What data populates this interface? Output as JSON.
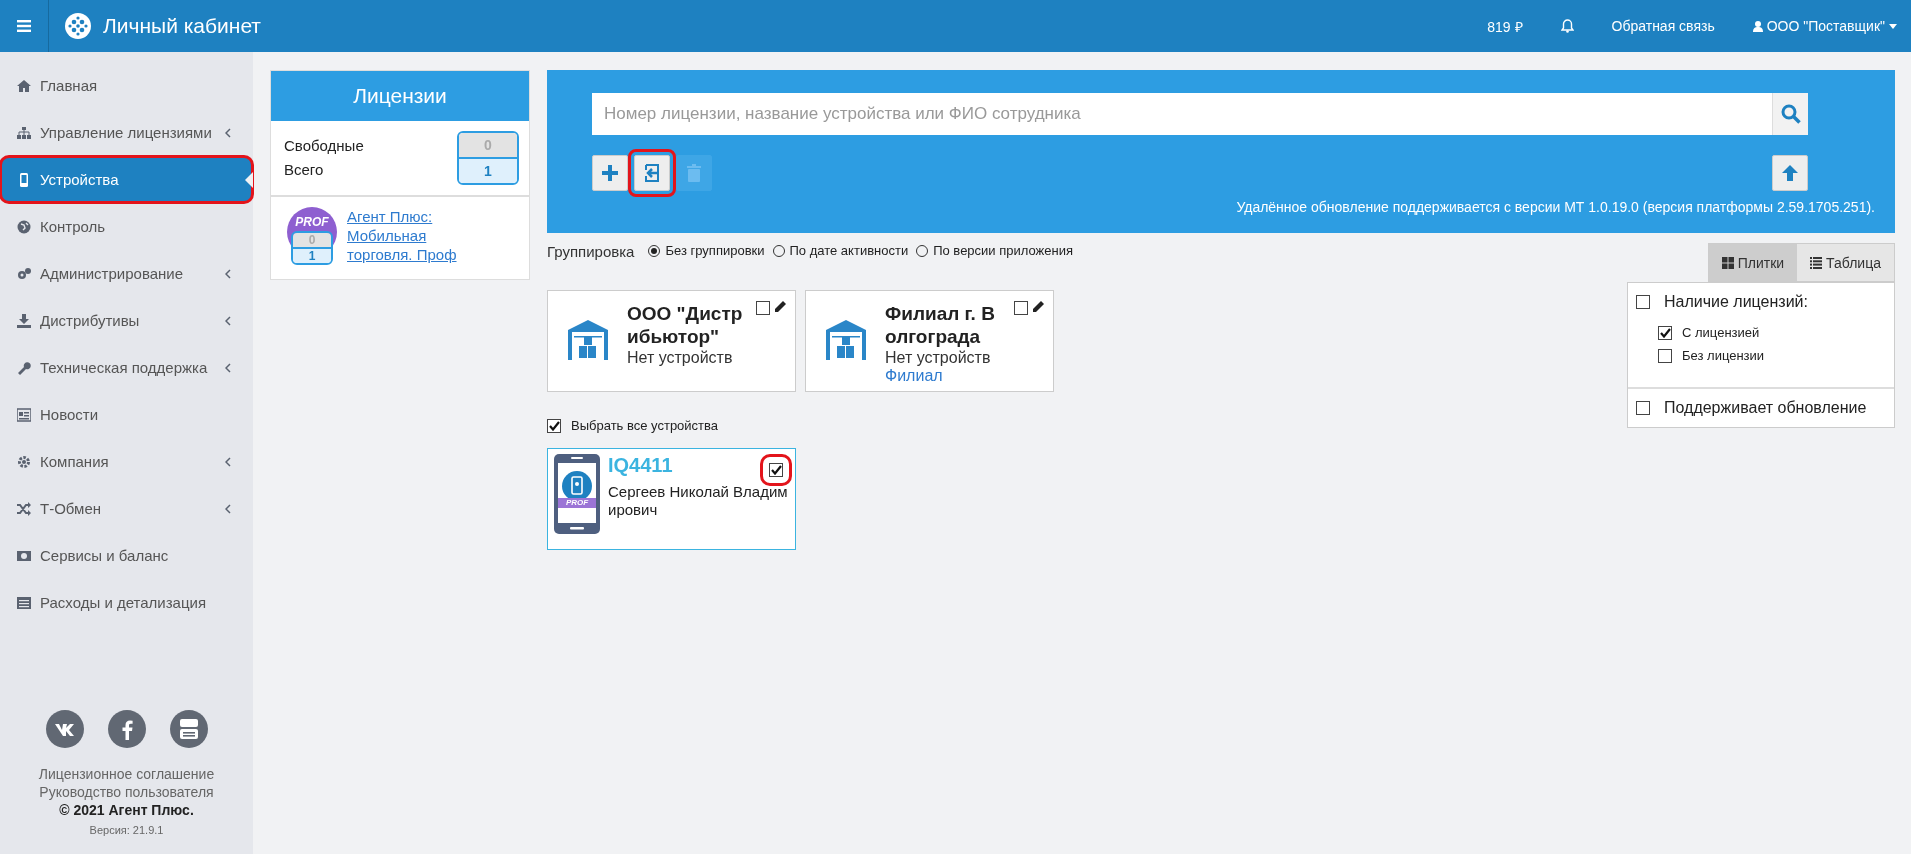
{
  "header": {
    "title": "Личный кабинет",
    "balance": "819 ₽",
    "feedback": "Обратная связь",
    "account": "ООО \"Поставщик\""
  },
  "sidebar": {
    "items": [
      {
        "label": "Главная",
        "has_submenu": false,
        "selected": false,
        "highlighted": false
      },
      {
        "label": "Управление лицензиями",
        "has_submenu": true,
        "selected": false,
        "highlighted": false
      },
      {
        "label": "Устройства",
        "has_submenu": false,
        "selected": true,
        "highlighted": true
      },
      {
        "label": "Контроль",
        "has_submenu": false,
        "selected": false,
        "highlighted": false
      },
      {
        "label": "Администрирование",
        "has_submenu": true,
        "selected": false,
        "highlighted": false
      },
      {
        "label": "Дистрибутивы",
        "has_submenu": true,
        "selected": false,
        "highlighted": false
      },
      {
        "label": "Техническая поддержка",
        "has_submenu": true,
        "selected": false,
        "highlighted": false
      },
      {
        "label": "Новости",
        "has_submenu": false,
        "selected": false,
        "highlighted": false
      },
      {
        "label": "Компания",
        "has_submenu": true,
        "selected": false,
        "highlighted": false
      },
      {
        "label": "Т-Обмен",
        "has_submenu": true,
        "selected": false,
        "highlighted": false
      },
      {
        "label": "Сервисы и баланс",
        "has_submenu": false,
        "selected": false,
        "highlighted": false
      },
      {
        "label": "Расходы и детализация",
        "has_submenu": false,
        "selected": false,
        "highlighted": false
      }
    ],
    "footer": {
      "links": [
        "Лицензионное соглашение",
        "Руководство пользователя"
      ],
      "copyright": "© 2021 Агент Плюс.",
      "version": "Версия: 21.9.1"
    }
  },
  "licenses": {
    "title": "Лицензии",
    "free_label": "Свободные",
    "total_label": "Всего",
    "free": "0",
    "total": "1",
    "products": [
      {
        "badge": "PROF",
        "free": "0",
        "total": "1",
        "name": "Агент Плюс: Мобильная торговля. Проф"
      }
    ]
  },
  "toolbar": {
    "search_placeholder": "Номер лицензии, название устройства или ФИО сотрудника",
    "buttons": [
      {
        "kind": "add",
        "disabled": false,
        "highlighted": false
      },
      {
        "kind": "import",
        "disabled": false,
        "highlighted": true
      },
      {
        "kind": "delete",
        "disabled": true,
        "highlighted": false
      }
    ],
    "note": "Удалённое обновление поддерживается с версии МТ 1.0.19.0 (версия платформы 2.59.1705.251)."
  },
  "grouping": {
    "label": "Группировка",
    "options": [
      {
        "label": "Без группировки",
        "selected": true
      },
      {
        "label": "По дате активности",
        "selected": false
      },
      {
        "label": "По версии приложения",
        "selected": false
      }
    ]
  },
  "view_toggle": [
    {
      "label": "Плитки",
      "selected": true
    },
    {
      "label": "Таблица",
      "selected": false
    }
  ],
  "organizations": [
    {
      "name": "ООО \"Дистрибьютор\"",
      "status": "Нет устройств",
      "checked": false
    },
    {
      "name": "Филиал г. Волгограда",
      "status": "Нет устройств",
      "type": "Филиал",
      "checked": false
    }
  ],
  "select_all": {
    "label": "Выбрать все устройства",
    "checked": true
  },
  "devices": [
    {
      "name": "IQ4411",
      "user": "Сергеев Николай Владимирович",
      "badge": "PROF",
      "checked": true,
      "highlighted": true
    }
  ],
  "filters": [
    {
      "title": "Наличие лицензий:",
      "checked": false,
      "options": [
        {
          "label": "С лицензией",
          "checked": true
        },
        {
          "label": "Без лицензии",
          "checked": false
        }
      ]
    },
    {
      "title": "Поддерживает обновление",
      "checked": false
    }
  ]
}
